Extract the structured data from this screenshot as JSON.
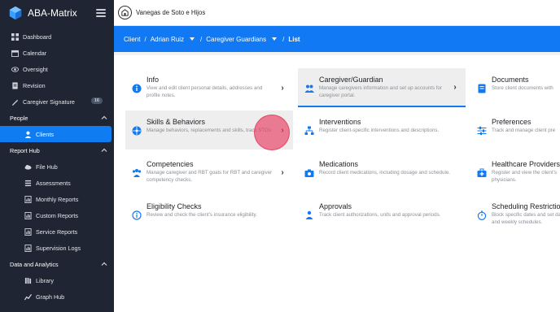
{
  "app": {
    "name": "ABA-Matrix"
  },
  "header": {
    "org_name": "Vanegas de Soto e Hijos"
  },
  "breadcrumb": {
    "root": "Client",
    "client": "Adrian Ruiz",
    "section": "Caregiver Guardians",
    "current": "List"
  },
  "sidebar": {
    "items": [
      {
        "label": "Dashboard",
        "icon": "dashboard-icon"
      },
      {
        "label": "Calendar",
        "icon": "calendar-icon"
      },
      {
        "label": "Oversight",
        "icon": "eye-icon"
      },
      {
        "label": "Revision",
        "icon": "document-icon"
      },
      {
        "label": "Caregiver Signature",
        "icon": "signature-icon",
        "badge": "16"
      }
    ],
    "people": {
      "label": "People",
      "items": [
        {
          "label": "Clients",
          "icon": "user-icon"
        }
      ]
    },
    "report_hub": {
      "label": "Report Hub",
      "items": [
        {
          "label": "File Hub",
          "icon": "cloud-icon"
        },
        {
          "label": "Assessments",
          "icon": "list-icon"
        },
        {
          "label": "Monthly Reports",
          "icon": "report-icon"
        },
        {
          "label": "Custom Reports",
          "icon": "report-icon"
        },
        {
          "label": "Service Reports",
          "icon": "report-icon"
        },
        {
          "label": "Supervision Logs",
          "icon": "report-icon"
        }
      ]
    },
    "data_analytics": {
      "label": "Data and Analytics",
      "items": [
        {
          "label": "Library",
          "icon": "library-icon"
        },
        {
          "label": "Graph Hub",
          "icon": "graph-icon"
        }
      ]
    }
  },
  "cards": {
    "info": {
      "title": "Info",
      "desc": "View and edit client personal details, addresses and profile notes."
    },
    "caregiver": {
      "title": "Caregiver/Guardian",
      "desc": "Manage caregivers information and set up accounts for caregiver portal."
    },
    "documents": {
      "title": "Documents",
      "desc": "Store client documents with"
    },
    "skills": {
      "title": "Skills & Behaviors",
      "desc": "Manage behaviors, replacements and skills, track STOs."
    },
    "interventions": {
      "title": "Interventions",
      "desc": "Register client-specific interventions and descriptions."
    },
    "preferences": {
      "title": "Preferences",
      "desc": "Track and manage client pre"
    },
    "competencies": {
      "title": "Competencies",
      "desc": "Manage caregiver and RBT goals for RBT and caregiver competency checks."
    },
    "medications": {
      "title": "Medications",
      "desc": "Record client medications, including dosage and schedule."
    },
    "healthcare": {
      "title": "Healthcare Providers",
      "desc": "Register and view the client's physicians."
    },
    "eligibility": {
      "title": "Eligibility Checks",
      "desc": "Review and check the client's insurance eligibility."
    },
    "approvals": {
      "title": "Approvals",
      "desc": "Track client authorizations, units and approval periods."
    },
    "scheduling": {
      "title": "Scheduling Restrictions",
      "desc": "Block specific dates and set daily and weekly schedules."
    }
  },
  "colors": {
    "accent": "#1279f5",
    "sidebar": "#1f2532",
    "touch": "#e63c5f"
  }
}
